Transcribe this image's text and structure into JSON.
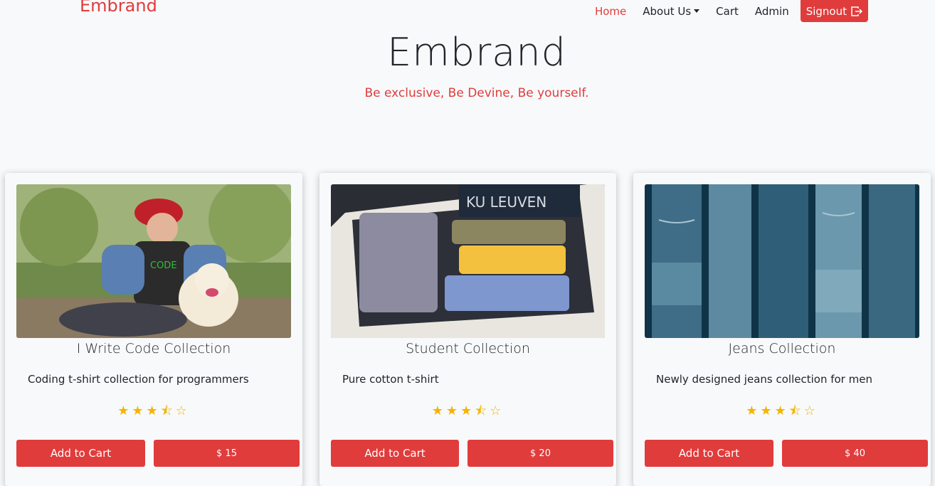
{
  "nav": {
    "brand": "Embrand",
    "home": "Home",
    "about": "About Us",
    "cart": "Cart",
    "admin": "Admin",
    "signout": "Signout"
  },
  "hero": {
    "title": "Embrand",
    "subtitle": "Be exclusive, Be Devine, Be yourself."
  },
  "products": [
    {
      "title": "I Write Code Collection",
      "description": "Coding t-shirt collection for programmers",
      "rating": 3.5,
      "stars": "★★★⯪☆",
      "add_to_cart": "Add to Cart",
      "price": "$ 15"
    },
    {
      "title": "Student Collection",
      "description": "Pure cotton t-shirt",
      "rating": 3.5,
      "stars": "★★★⯪☆",
      "add_to_cart": "Add to Cart",
      "price": "$ 20"
    },
    {
      "title": "Jeans Collection",
      "description": "Newly designed jeans collection for men",
      "rating": 3.5,
      "stars": "★★★⯪☆",
      "add_to_cart": "Add to Cart",
      "price": "$ 40"
    }
  ],
  "colors": {
    "accent": "#e03c3c",
    "star": "#f4b400",
    "background": "#f8f9fb"
  }
}
